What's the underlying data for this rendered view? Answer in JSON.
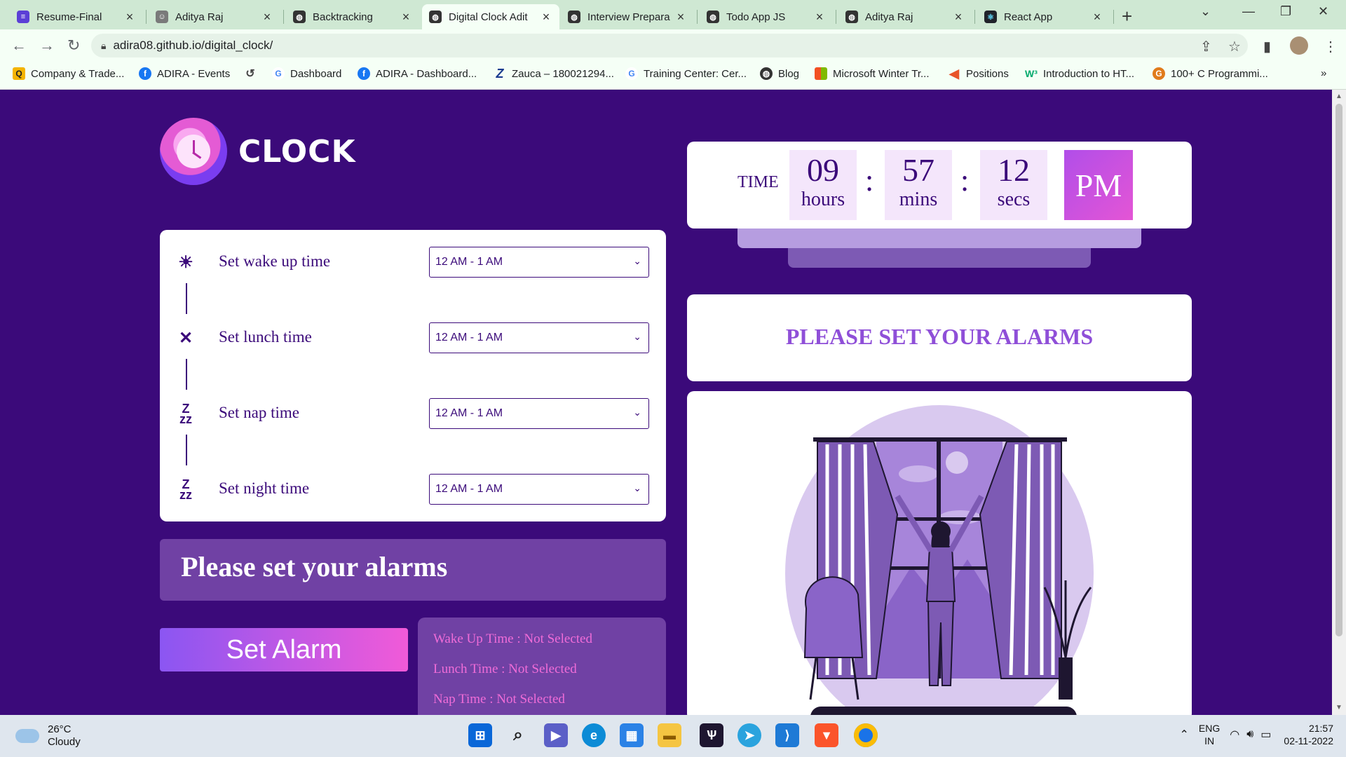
{
  "browser": {
    "tabs": [
      {
        "title": "Resume-Final",
        "icon": "docs-icon",
        "color": "#5b3fd6"
      },
      {
        "title": "Aditya Raj",
        "icon": "profile-icon",
        "color": "#7a7a7a"
      },
      {
        "title": "Backtracking",
        "icon": "globe-icon",
        "color": "#333333"
      },
      {
        "title": "Digital Clock Adit",
        "icon": "globe-icon",
        "color": "#333333"
      },
      {
        "title": "Interview Prepara",
        "icon": "globe-icon",
        "color": "#333333"
      },
      {
        "title": "Todo App JS",
        "icon": "globe-icon",
        "color": "#333333"
      },
      {
        "title": "Aditya Raj",
        "icon": "globe-icon",
        "color": "#333333"
      },
      {
        "title": "React App",
        "icon": "react-icon",
        "color": "#20232a"
      }
    ],
    "new_tab_label": "+",
    "url": "adira08.github.io/digital_clock/",
    "bookmarks": [
      {
        "label": "Company & Trade...",
        "icon": "q-icon",
        "color": "#f4b400"
      },
      {
        "label": "ADIRA - Events",
        "icon": "facebook-icon",
        "color": "#1877f2"
      },
      {
        "label": "",
        "icon": "history-icon",
        "color": "#444444"
      },
      {
        "label": "Dashboard",
        "icon": "google-icon",
        "color": "#4285f4"
      },
      {
        "label": "ADIRA - Dashboard...",
        "icon": "facebook-icon",
        "color": "#1877f2"
      },
      {
        "label": "Zauca – 180021294...",
        "icon": "z-icon",
        "color": "#1a3c8f"
      },
      {
        "label": "Training Center: Cer...",
        "icon": "google-icon",
        "color": "#4285f4"
      },
      {
        "label": "Blog",
        "icon": "globe-icon",
        "color": "#333333"
      },
      {
        "label": "Microsoft Winter Tr...",
        "icon": "microsoft-icon",
        "color": "#f25022"
      },
      {
        "label": "Positions",
        "icon": "arrow-icon",
        "color": "#e8542a"
      },
      {
        "label": "Introduction to HT...",
        "icon": "w3-icon",
        "color": "#04aa6d"
      },
      {
        "label": "100+ C Programmi...",
        "icon": "gfg-icon",
        "color": "#e07b1b"
      }
    ],
    "more_bookmarks": "»"
  },
  "app": {
    "logo_text": "CLOCK",
    "alarms": [
      {
        "label": "Set wake up time",
        "icon": "sun-icon",
        "value": "12 AM - 1 AM"
      },
      {
        "label": "Set lunch time",
        "icon": "fork-knife-icon",
        "value": "12 AM - 1 AM"
      },
      {
        "label": "Set nap time",
        "icon": "zzz-icon",
        "value": "12 AM - 1 AM"
      },
      {
        "label": "Set night time",
        "icon": "zzz-icon",
        "value": "12 AM - 1 AM"
      }
    ],
    "status_message": "Please set your alarms",
    "set_alarm_label": "Set Alarm",
    "summary": [
      "Wake Up Time : Not Selected",
      "Lunch Time : Not Selected",
      "Nap Time : Not Selected"
    ],
    "time": {
      "label": "TIME",
      "hours": "09",
      "hours_unit": "hours",
      "mins": "57",
      "mins_unit": "mins",
      "secs": "12",
      "secs_unit": "secs",
      "ampm": "PM",
      "sep": ":"
    },
    "message_banner": "PLEASE SET YOUR ALARMS"
  },
  "taskbar": {
    "weather_temp": "26°C",
    "weather_desc": "Cloudy",
    "lang_1": "ENG",
    "lang_2": "IN",
    "clock_time": "21:57",
    "clock_date": "02-11-2022"
  },
  "colors": {
    "page_bg": "#3b0a7a",
    "accent_purple": "#8f4fd8",
    "pink": "#f15ad8"
  }
}
